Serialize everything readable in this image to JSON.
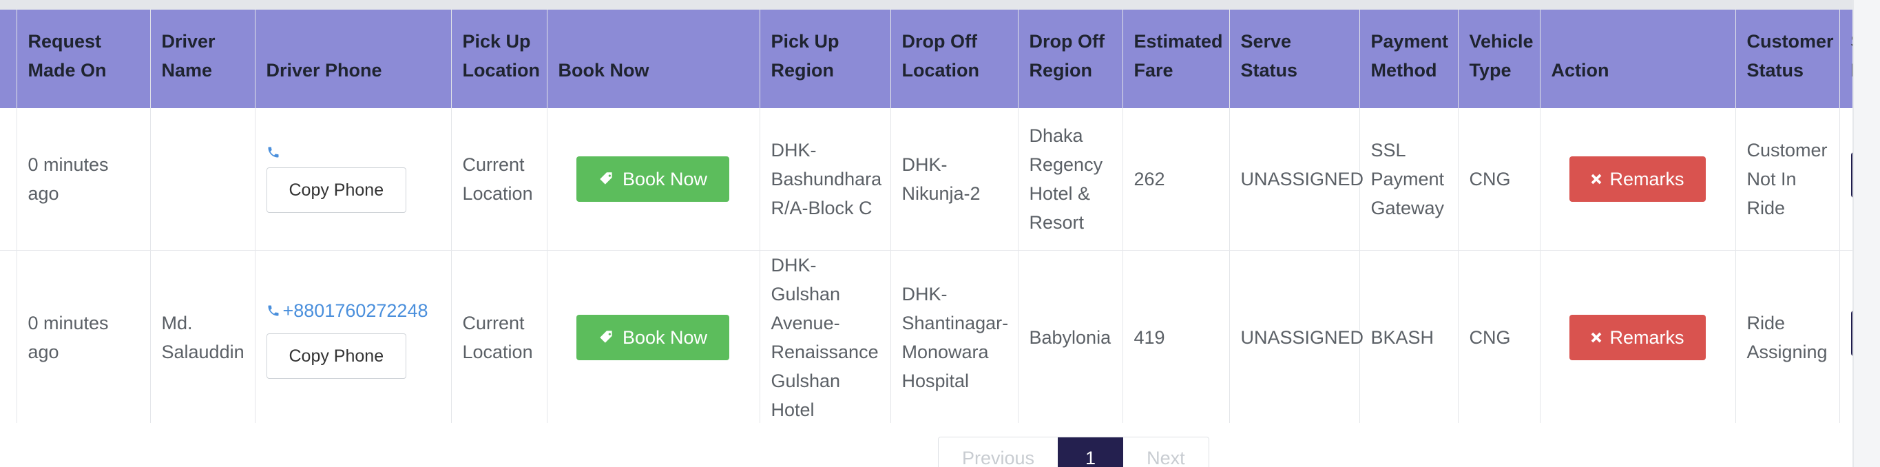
{
  "table": {
    "headers": [
      "",
      "Request Made On",
      "Driver Name",
      "Driver Phone",
      "Pick Up Location",
      "Book Now",
      "Pick Up Region",
      "Drop Off Location",
      "Drop Off Region",
      "Estimated Fare",
      "Serve Status",
      "Payment Method",
      "Vehicle Type",
      "Action",
      "Customer Status",
      "S N"
    ],
    "rows": [
      {
        "request_made_on": "0 minutes ago",
        "driver_name": "",
        "driver_phone": "",
        "copy_phone_label": "Copy Phone",
        "pick_up_location": "Current Location",
        "book_now_label": "Book Now",
        "pick_up_region": "DHK-Bashundhara R/A-Block C",
        "drop_off_location": "DHK-Nikunja-2",
        "drop_off_region": "Dhaka Regency Hotel & Resort",
        "estimated_fare": "262",
        "serve_status": "UNASSIGNED",
        "payment_method": "SSL Payment Gateway",
        "vehicle_type": "CNG",
        "action_label": "Remarks",
        "customer_status": "Customer Not In Ride"
      },
      {
        "request_made_on": "0 minutes ago",
        "driver_name": "Md. Salauddin",
        "driver_phone": "+8801760272248",
        "copy_phone_label": "Copy Phone",
        "pick_up_location": "Current Location",
        "book_now_label": "Book Now",
        "pick_up_region": "DHK-Gulshan Avenue-Renaissance Gulshan Hotel",
        "drop_off_location": "DHK-Shantinagar-Monowara Hospital",
        "drop_off_region": "Babylonia",
        "estimated_fare": "419",
        "serve_status": "UNASSIGNED",
        "payment_method": "BKASH",
        "vehicle_type": "CNG",
        "action_label": "Remarks",
        "customer_status": "Ride Assigning"
      }
    ]
  },
  "pagination": {
    "previous_label": "Previous",
    "current_page": "1",
    "next_label": "Next"
  },
  "colors": {
    "header_bg": "#8c8bd6",
    "book_now": "#5cbd5c",
    "remarks": "#d9534f",
    "phone_link": "#4a8fdc",
    "pager_active": "#24204f"
  },
  "icons": {
    "phone": "phone-icon",
    "book": "ticket-icon",
    "remarks": "times-icon"
  }
}
